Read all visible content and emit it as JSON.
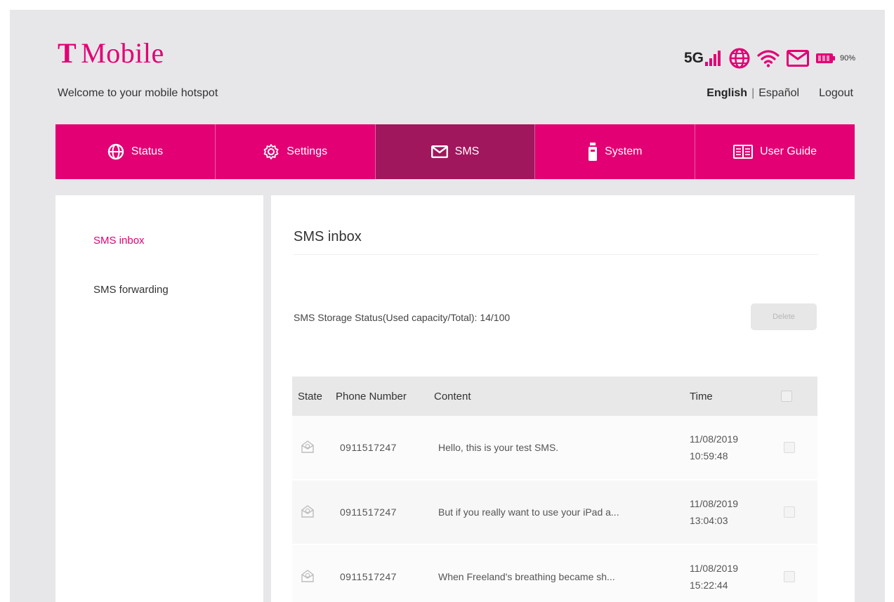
{
  "brand": {
    "name": "Mobile",
    "mark": "T",
    "color": "#e20074"
  },
  "header": {
    "welcome": "Welcome to your mobile hotspot",
    "network": "5G",
    "battery_percent": "90%",
    "language_active": "English",
    "language_separator": "|",
    "language_other": "Español",
    "logout": "Logout"
  },
  "nav": {
    "status": "Status",
    "settings": "Settings",
    "sms": "SMS",
    "system": "System",
    "user_guide": "User Guide"
  },
  "sidebar": {
    "items": [
      {
        "label": "SMS inbox"
      },
      {
        "label": "SMS forwarding"
      }
    ]
  },
  "main": {
    "title": "SMS inbox",
    "storage_status": "SMS Storage Status(Used capacity/Total): 14/100",
    "delete_label": "Delete",
    "columns": {
      "state": "State",
      "phone": "Phone Number",
      "content": "Content",
      "time": "Time"
    },
    "rows": [
      {
        "phone": "0911517247",
        "content": "Hello, this is your test SMS.",
        "date": "11/08/2019",
        "time": "10:59:48"
      },
      {
        "phone": "0911517247",
        "content": "But if you really want to use your iPad a...",
        "date": "11/08/2019",
        "time": "13:04:03"
      },
      {
        "phone": "0911517247",
        "content": "When Freeland's breathing became sh...",
        "date": "11/08/2019",
        "time": "15:22:44"
      }
    ]
  }
}
